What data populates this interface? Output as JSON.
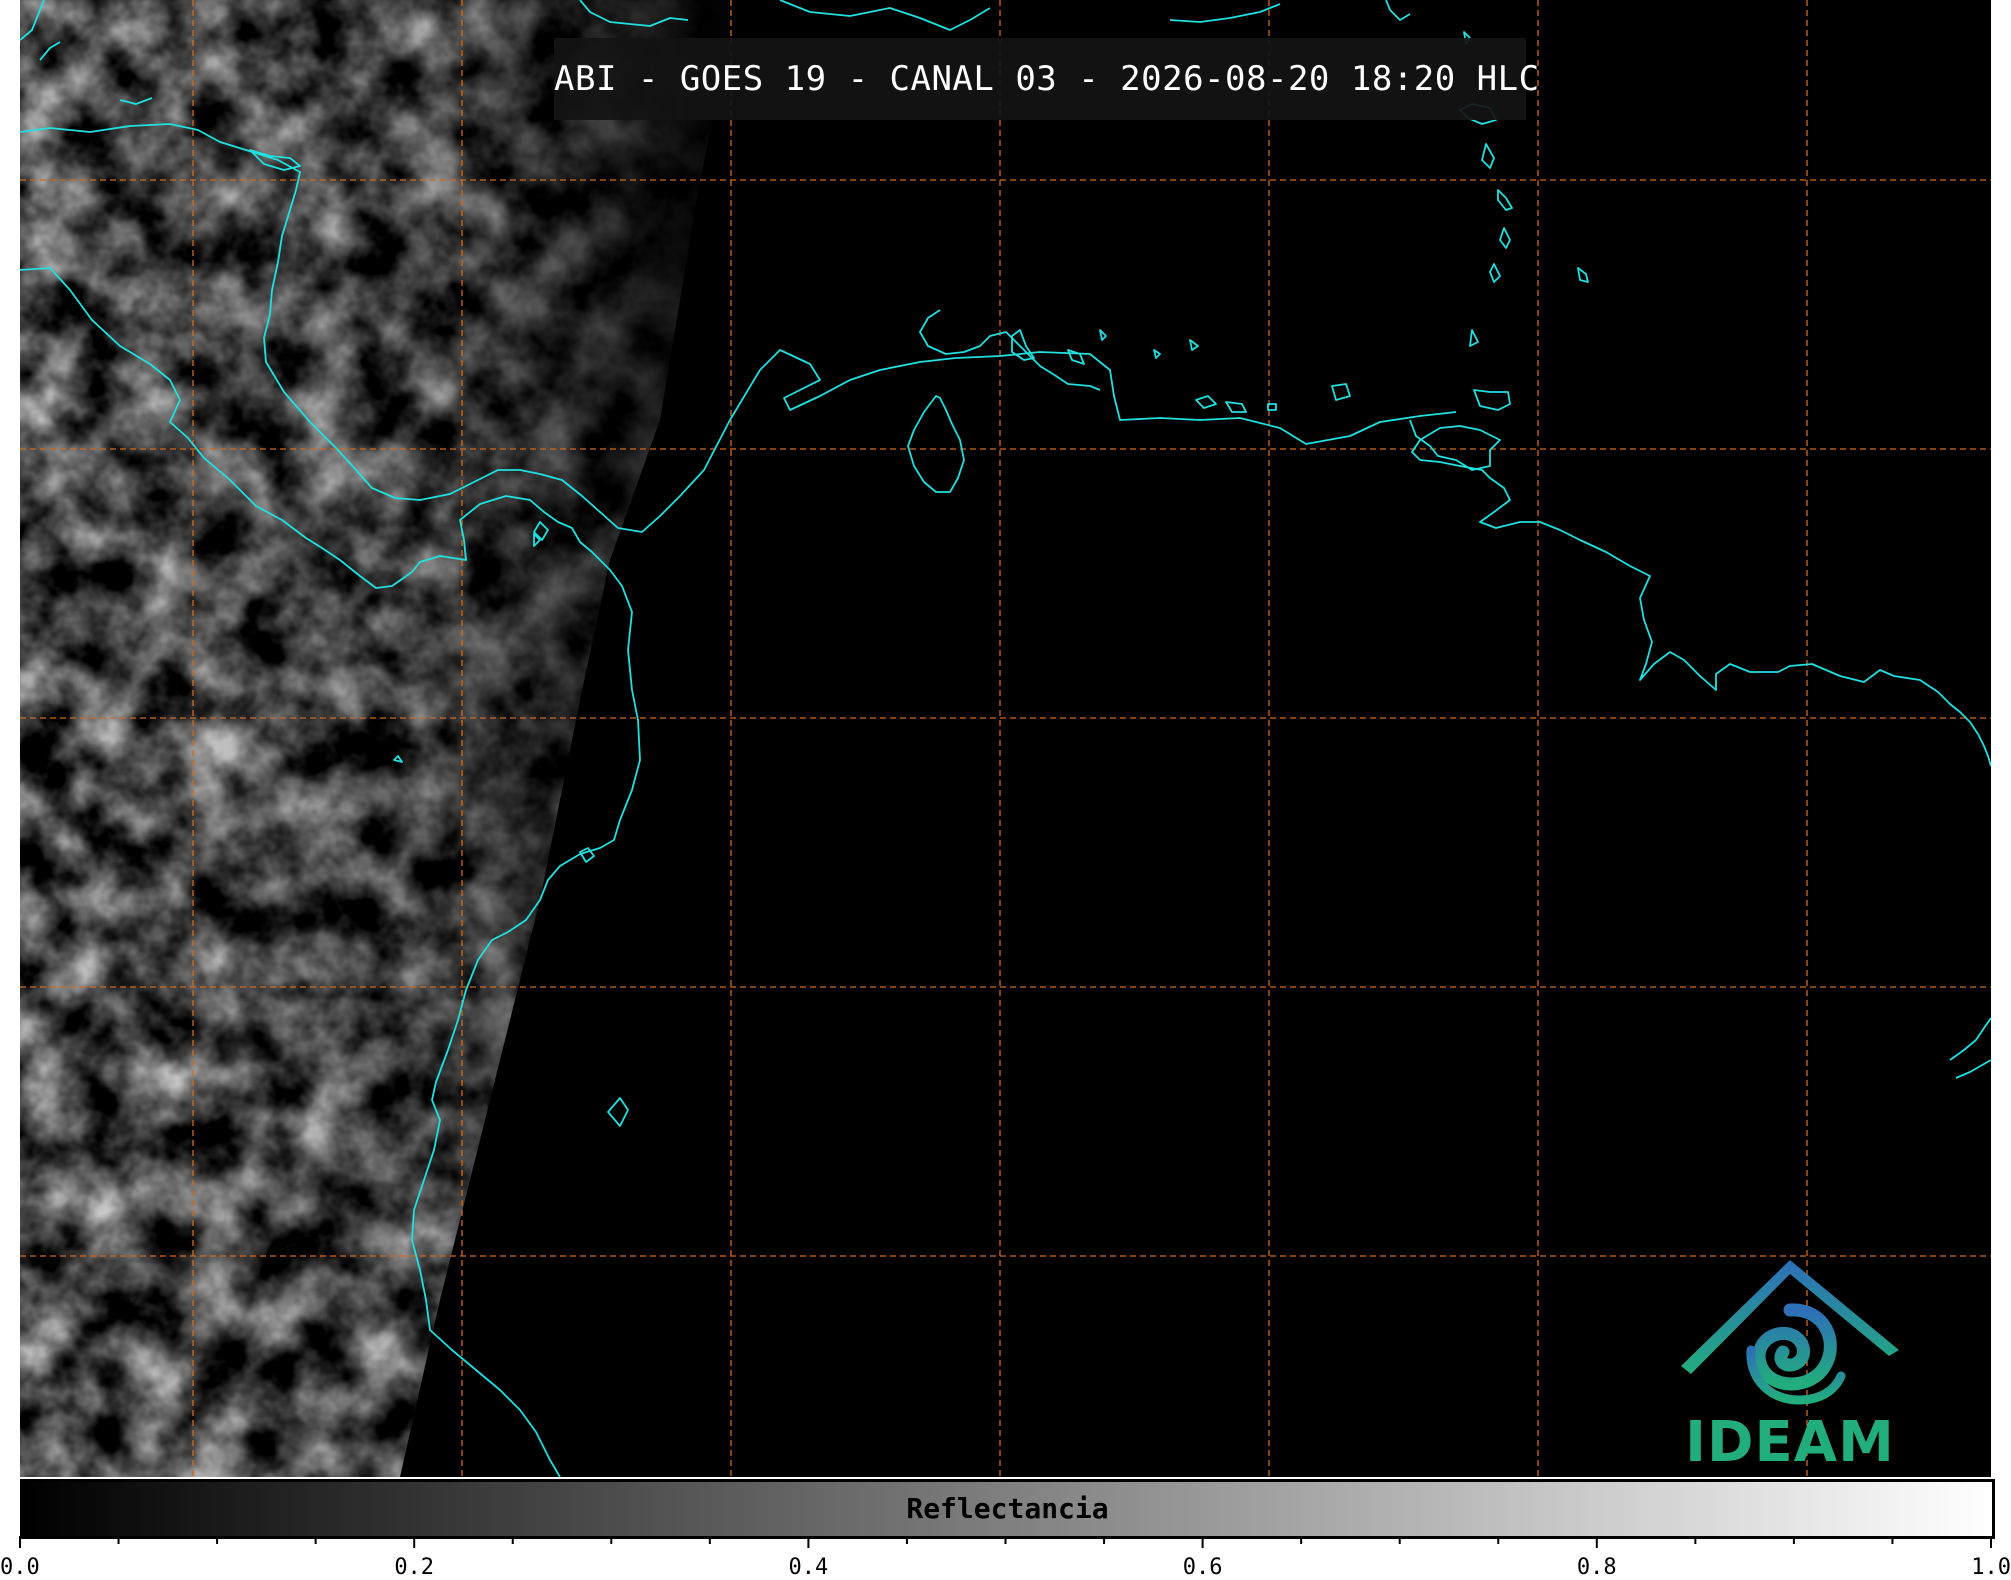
{
  "title": "ABI - GOES 19 - CANAL 03 - 2026-08-20 18:20 HLC",
  "colorbar": {
    "label": "Reflectancia",
    "min": 0.0,
    "max": 1.0,
    "tick_labels": [
      "0.0",
      "0.2",
      "0.4",
      "0.6",
      "0.8",
      "1.0"
    ],
    "colormap": [
      "#000000",
      "#ffffff"
    ]
  },
  "logo": {
    "text": "IDEAM",
    "colors": [
      "#2e6fb8",
      "#22ad7d"
    ]
  },
  "colors": {
    "coastline": "#20e0e0",
    "gridline": "#d2691e",
    "background": "#000000",
    "cloud": "#9a9a9a"
  },
  "map": {
    "gridlines": true,
    "gridline_style": "dashed"
  }
}
